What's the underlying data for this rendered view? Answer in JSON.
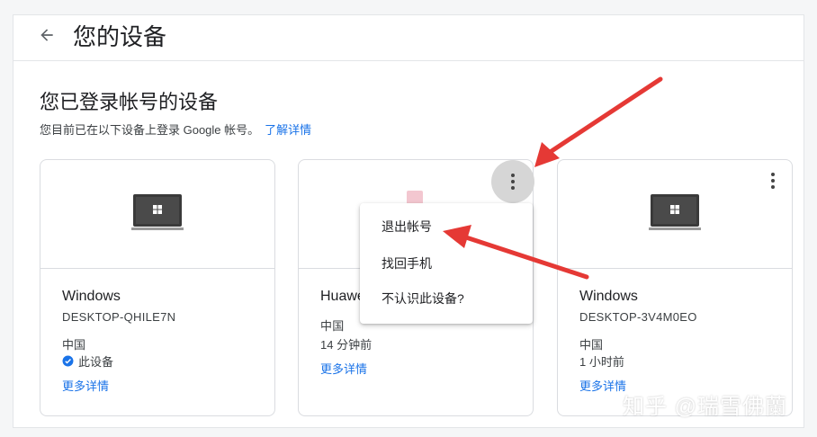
{
  "header": {
    "title": "您的设备"
  },
  "section": {
    "title": "您已登录帐号的设备",
    "description": "您目前已在以下设备上登录 Google 帐号。",
    "link": "了解详情"
  },
  "cards": [
    {
      "name": "Windows",
      "id": "DESKTOP-QHILE7N",
      "location": "中国",
      "status": "此设备",
      "link": "更多详情"
    },
    {
      "name": "Huawei",
      "location": "中国",
      "time": "14 分钟前",
      "link": "更多详情"
    },
    {
      "name": "Windows",
      "id": "DESKTOP-3V4M0EO",
      "location": "中国",
      "time": "1 小时前",
      "link": "更多详情"
    }
  ],
  "menu": {
    "items": [
      "退出帐号",
      "找回手机",
      "不认识此设备?"
    ]
  },
  "watermark": "知乎 @瑞雪佛蘭",
  "colors": {
    "link": "#1a73e8",
    "arrow": "#e53935",
    "check": "#1a73e8"
  },
  "icons": [
    "back-arrow-icon",
    "laptop-icon",
    "more-vert-icon",
    "verified-check-icon"
  ]
}
